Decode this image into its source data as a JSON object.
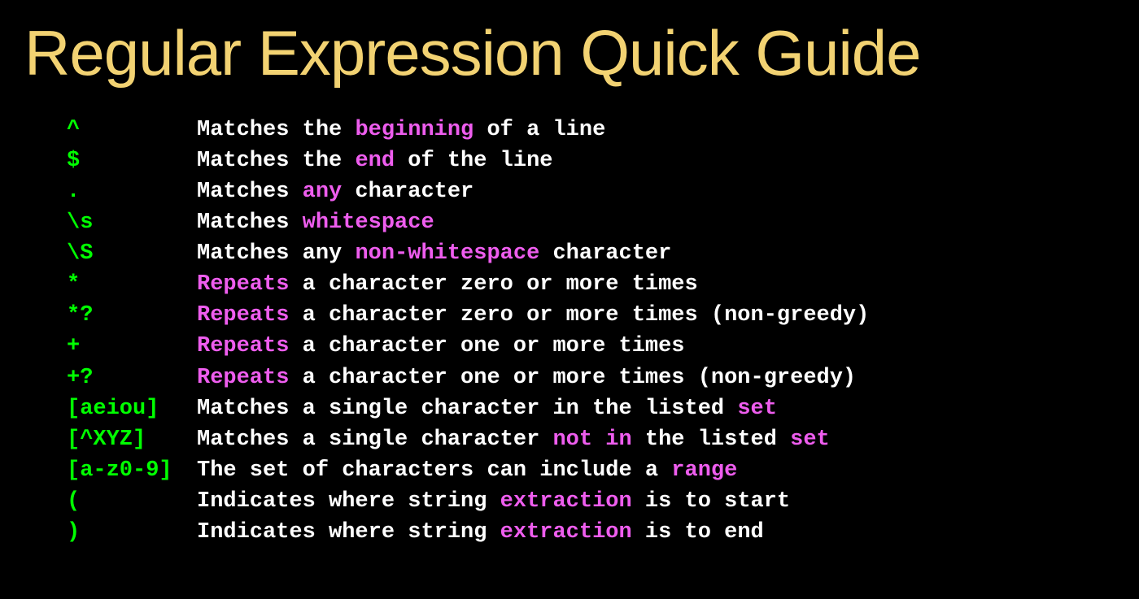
{
  "title": "Regular Expression Quick Guide",
  "rows": [
    {
      "symbol": "^",
      "parts": [
        {
          "t": "Matches the "
        },
        {
          "t": "beginning",
          "hl": true
        },
        {
          "t": " of a line"
        }
      ]
    },
    {
      "symbol": "$",
      "parts": [
        {
          "t": "Matches the "
        },
        {
          "t": "end",
          "hl": true
        },
        {
          "t": " of the line"
        }
      ]
    },
    {
      "symbol": ".",
      "parts": [
        {
          "t": "Matches "
        },
        {
          "t": "any",
          "hl": true
        },
        {
          "t": " character"
        }
      ]
    },
    {
      "symbol": "\\s",
      "parts": [
        {
          "t": "Matches "
        },
        {
          "t": "whitespace",
          "hl": true
        }
      ]
    },
    {
      "symbol": "\\S",
      "parts": [
        {
          "t": "Matches any "
        },
        {
          "t": "non-whitespace",
          "hl": true
        },
        {
          "t": " character"
        }
      ]
    },
    {
      "symbol": "*",
      "parts": [
        {
          "t": "Repeats",
          "hl": true
        },
        {
          "t": " a character zero or more times"
        }
      ]
    },
    {
      "symbol": "*?",
      "parts": [
        {
          "t": "Repeats",
          "hl": true
        },
        {
          "t": " a character zero or more times (non-greedy)"
        }
      ]
    },
    {
      "symbol": "+",
      "parts": [
        {
          "t": "Repeats",
          "hl": true
        },
        {
          "t": " a character one or more times"
        }
      ]
    },
    {
      "symbol": "+?",
      "parts": [
        {
          "t": "Repeats",
          "hl": true
        },
        {
          "t": " a character one or more times (non-greedy)"
        }
      ]
    },
    {
      "symbol": "[aeiou]",
      "parts": [
        {
          "t": "Matches a single character in the listed "
        },
        {
          "t": "set",
          "hl": true
        }
      ]
    },
    {
      "symbol": "[^XYZ]",
      "parts": [
        {
          "t": "Matches a single character "
        },
        {
          "t": "not in",
          "hl": true
        },
        {
          "t": " the listed "
        },
        {
          "t": "set",
          "hl": true
        }
      ]
    },
    {
      "symbol": "[a-z0-9]",
      "parts": [
        {
          "t": "The set of characters can include a "
        },
        {
          "t": "range",
          "hl": true
        }
      ]
    },
    {
      "symbol": "(",
      "parts": [
        {
          "t": "Indicates where string "
        },
        {
          "t": "extraction",
          "hl": true
        },
        {
          "t": " is to start"
        }
      ]
    },
    {
      "symbol": ")",
      "parts": [
        {
          "t": "Indicates where string "
        },
        {
          "t": "extraction",
          "hl": true
        },
        {
          "t": " is to end"
        }
      ]
    }
  ]
}
